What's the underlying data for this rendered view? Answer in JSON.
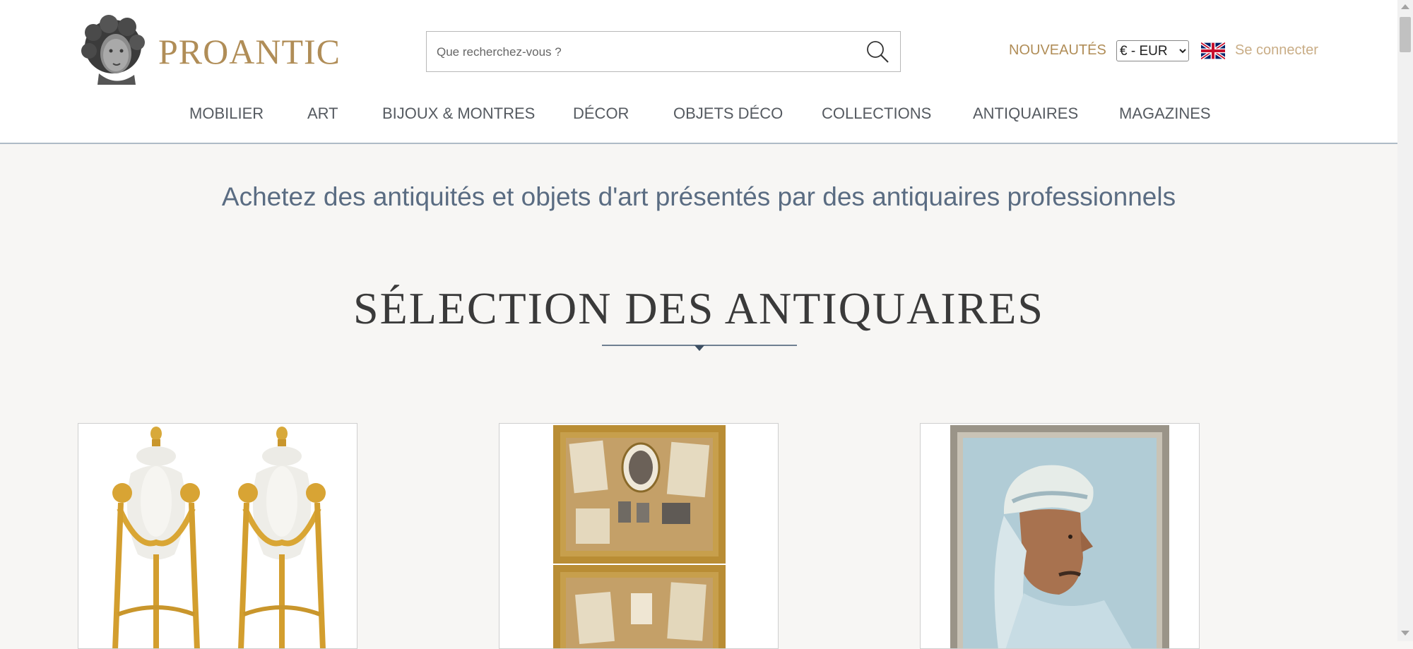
{
  "header": {
    "logo_text": "PROANTIC",
    "search_placeholder": "Que recherchez-vous ?",
    "nouveautes": "NOUVEAUTÉS",
    "currency": {
      "selected": "€ - EUR",
      "options": [
        "€ - EUR"
      ]
    },
    "language_flag": "uk-flag-icon",
    "login": "Se connecter"
  },
  "nav": {
    "items": [
      "MOBILIER",
      "ART",
      "BIJOUX & MONTRES",
      "DÉCOR",
      "OBJETS DÉCO",
      "COLLECTIONS",
      "ANTIQUAIRES",
      "MAGAZINES"
    ]
  },
  "main": {
    "tagline": "Achetez des antiquités et objets d'art présentés par des antiquaires professionnels",
    "section_title": "SÉLECTION DES ANTIQUAIRES"
  },
  "colors": {
    "brand_gold": "#b08d57",
    "login_gold": "#c9ad86",
    "tagline_blue": "#5a6c82",
    "background": "#f7f6f4"
  }
}
